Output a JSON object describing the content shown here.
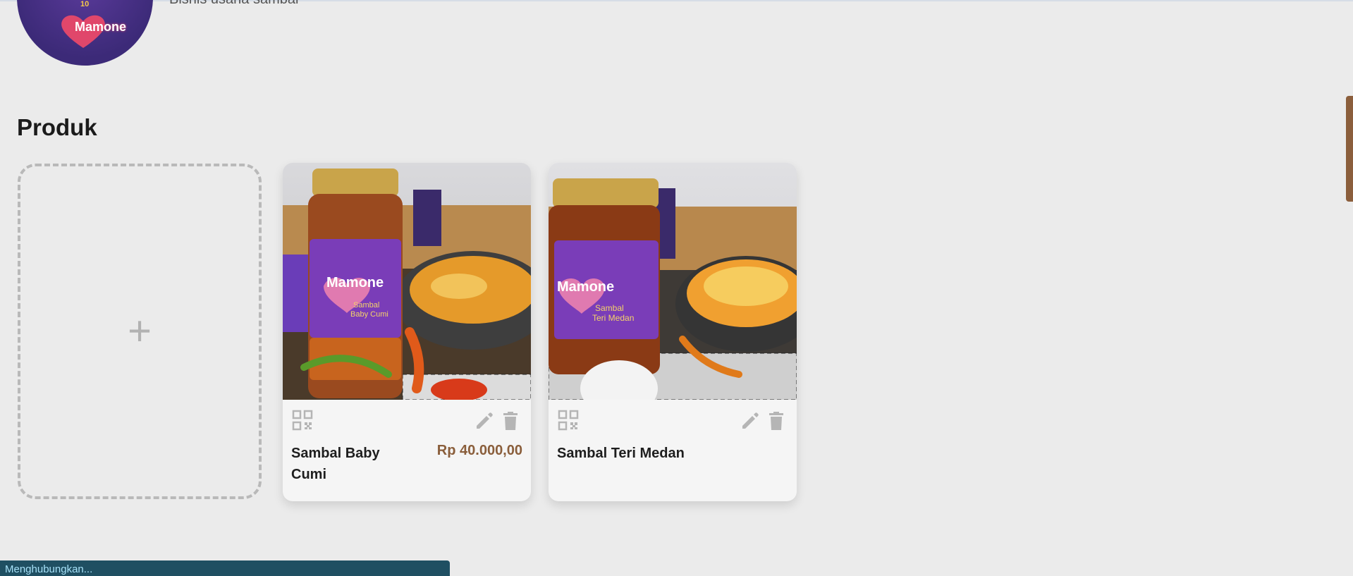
{
  "header": {
    "logo_brand": "Mamone",
    "logo_number": "10",
    "subtitle": "Bisnis usaha sambal"
  },
  "section": {
    "title": "Produk"
  },
  "add_card": {
    "symbol": "+"
  },
  "products": [
    {
      "name": "Sambal Baby Cumi",
      "price": "Rp 40.000,00",
      "jar_label": "Sambal Baby Cumi"
    },
    {
      "name": "Sambal Teri Medan",
      "price": "",
      "jar_label": "Sambal Teri Medan"
    }
  ],
  "status": {
    "text": "Menghubungkan..."
  },
  "colors": {
    "background": "#ebebeb",
    "price": "#8a5e3b",
    "jar_label": "#7a3db8",
    "status_bar": "#1f4f62",
    "accent_tab": "#8b5e3c"
  },
  "icons": [
    "qr-code-icon",
    "edit-icon",
    "delete-icon",
    "plus-icon"
  ]
}
